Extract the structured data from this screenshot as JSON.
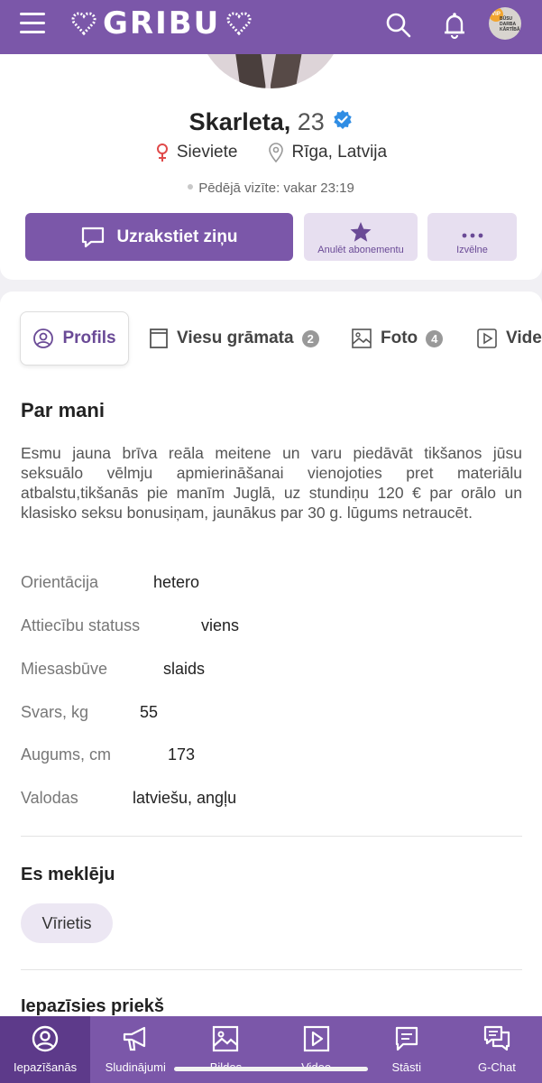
{
  "header": {
    "logo": "GRIBU",
    "vip_badge": "VIP",
    "vip_text": "BŪSU DARBA KĀRTĪBĀ",
    "colors": {
      "brand": "#7b57a9",
      "accent": "#6a4a96"
    }
  },
  "profile": {
    "name": "Skarleta,",
    "age": "23",
    "gender": "Sieviete",
    "location": "Rīga, Latvija",
    "last_visit": "Pēdējā vizīte: vakar 23:19"
  },
  "actions": {
    "message": "Uzrakstiet ziņu",
    "unsubscribe": "Anulēt abonementu",
    "menu": "Izvēlne"
  },
  "tabs": [
    {
      "label": "Profils",
      "icon": "user-circle-icon"
    },
    {
      "label": "Viesu grāmata",
      "count": "2",
      "icon": "book-icon"
    },
    {
      "label": "Foto",
      "count": "4",
      "icon": "image-icon"
    },
    {
      "label": "Vide",
      "icon": "play-icon"
    }
  ],
  "about": {
    "title": "Par mani",
    "text": "Esmu jauna brīva reāla meitene un varu piedāvāt tikšanos jūsu seksuālo vēlmju apmierināšanai vienojoties pret materiālu atbalstu,tikšanās pie manīm Juglā, uz stundiņu 120 € par orālo un klasisko seksu bonusiņam, jaunākus par 30 g. lūgums netraucēt.",
    "attributes": [
      {
        "label": "Orientācija",
        "value": "hetero"
      },
      {
        "label": "Attiecību statuss",
        "value": "viens"
      },
      {
        "label": "Miesasbūve",
        "value": "slaids"
      },
      {
        "label": "Svars, kg",
        "value": "55"
      },
      {
        "label": "Augums, cm",
        "value": "173"
      },
      {
        "label": "Valodas",
        "value": "latviešu, angļu"
      }
    ]
  },
  "looking_for": {
    "title": "Es meklēju",
    "value": "Vīrietis"
  },
  "next_section": {
    "title": "Iepazīsies priekš"
  },
  "bottom_nav": [
    {
      "label": "Iepazīšanās",
      "icon": "user-circle-icon"
    },
    {
      "label": "Sludinājumi",
      "icon": "megaphone-icon"
    },
    {
      "label": "Bildes",
      "icon": "image-icon"
    },
    {
      "label": "Video",
      "icon": "play-icon"
    },
    {
      "label": "Stāsti",
      "icon": "story-icon"
    },
    {
      "label": "G-Chat",
      "icon": "chat-icon"
    }
  ]
}
